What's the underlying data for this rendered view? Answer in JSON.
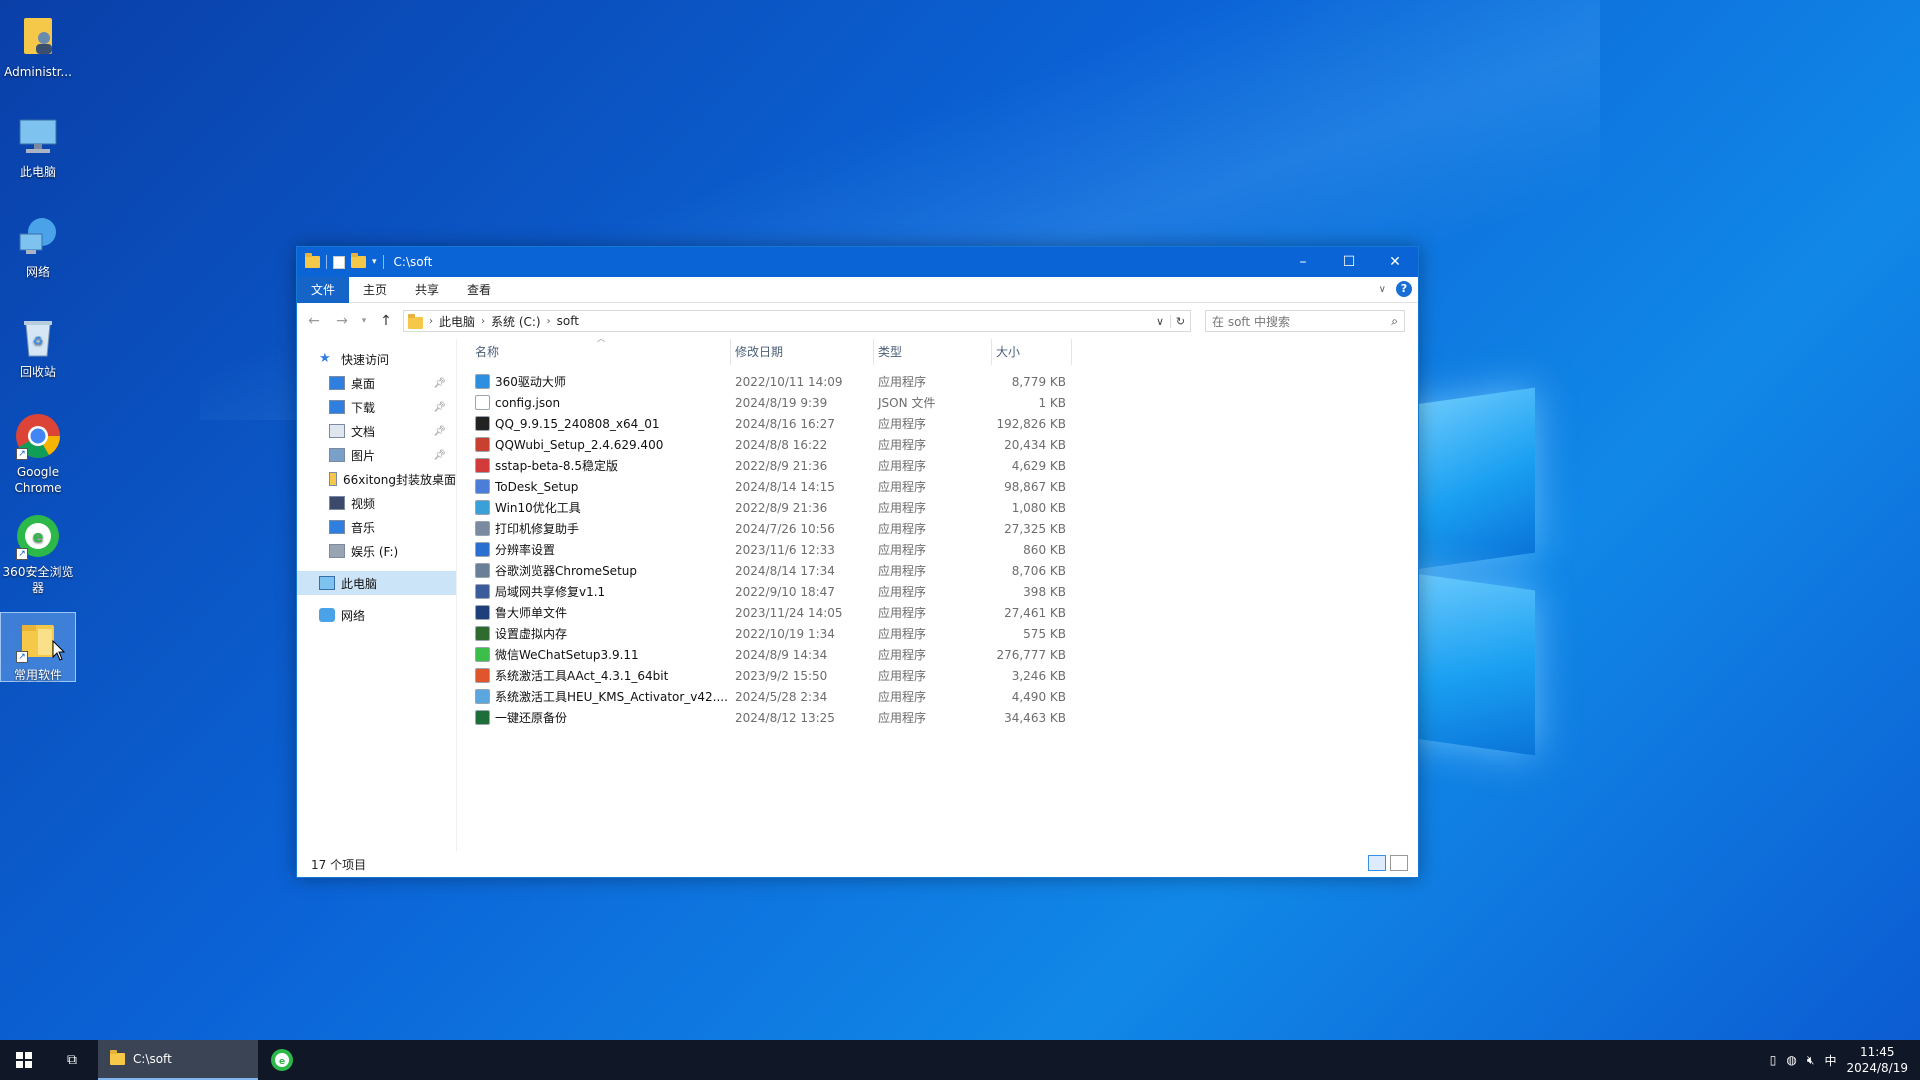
{
  "desktop": {
    "icons": [
      {
        "label": "Administr...",
        "icon": "user-folder-icon"
      },
      {
        "label": "此电脑",
        "icon": "this-pc-icon"
      },
      {
        "label": "网络",
        "icon": "network-icon"
      },
      {
        "label": "回收站",
        "icon": "recycle-bin-icon"
      },
      {
        "label": "Google Chrome",
        "icon": "chrome-icon"
      },
      {
        "label": "360安全浏览器",
        "icon": "360-browser-icon"
      },
      {
        "label": "常用软件",
        "icon": "folder-icon"
      }
    ]
  },
  "window": {
    "title": "C:\\soft",
    "ribbon_tabs": [
      "文件",
      "主页",
      "共享",
      "查看"
    ],
    "breadcrumb": [
      "此电脑",
      "系统 (C:)",
      "soft"
    ],
    "search_placeholder": "在 soft 中搜索",
    "nav": {
      "quick_access": "快速访问",
      "items": [
        {
          "label": "桌面",
          "icon": "desktop-icon",
          "pinned": true
        },
        {
          "label": "下载",
          "icon": "download-icon",
          "pinned": true
        },
        {
          "label": "文档",
          "icon": "document-icon",
          "pinned": true
        },
        {
          "label": "图片",
          "icon": "picture-icon",
          "pinned": true
        },
        {
          "label": "66xitong封装放桌面",
          "icon": "folder-icon",
          "pinned": false
        },
        {
          "label": "视频",
          "icon": "video-icon",
          "pinned": false
        },
        {
          "label": "音乐",
          "icon": "music-icon",
          "pinned": false
        },
        {
          "label": "娱乐 (F:)",
          "icon": "drive-icon",
          "pinned": false
        }
      ],
      "this_pc": "此电脑",
      "network": "网络"
    },
    "columns": {
      "name": "名称",
      "date": "修改日期",
      "type": "类型",
      "size": "大小"
    },
    "files": [
      {
        "name": "360驱动大师",
        "date": "2022/10/11 14:09",
        "type": "应用程序",
        "size": "8,779 KB",
        "color": "#2d8fe0"
      },
      {
        "name": "config.json",
        "date": "2024/8/19 9:39",
        "type": "JSON 文件",
        "size": "1 KB",
        "color": "#ffffff"
      },
      {
        "name": "QQ_9.9.15_240808_x64_01",
        "date": "2024/8/16 16:27",
        "type": "应用程序",
        "size": "192,826 KB",
        "color": "#222222"
      },
      {
        "name": "QQWubi_Setup_2.4.629.400",
        "date": "2024/8/8 16:22",
        "type": "应用程序",
        "size": "20,434 KB",
        "color": "#c8402f"
      },
      {
        "name": "sstap-beta-8.5稳定版",
        "date": "2022/8/9 21:36",
        "type": "应用程序",
        "size": "4,629 KB",
        "color": "#d33b3b"
      },
      {
        "name": "ToDesk_Setup",
        "date": "2024/8/14 14:15",
        "type": "应用程序",
        "size": "98,867 KB",
        "color": "#4a7ed8"
      },
      {
        "name": "Win10优化工具",
        "date": "2022/8/9 21:36",
        "type": "应用程序",
        "size": "1,080 KB",
        "color": "#3aa0d8"
      },
      {
        "name": "打印机修复助手",
        "date": "2024/7/26 10:56",
        "type": "应用程序",
        "size": "27,325 KB",
        "color": "#7a8aa0"
      },
      {
        "name": "分辨率设置",
        "date": "2023/11/6 12:33",
        "type": "应用程序",
        "size": "860 KB",
        "color": "#2a6fd0"
      },
      {
        "name": "谷歌浏览器ChromeSetup",
        "date": "2024/8/14 17:34",
        "type": "应用程序",
        "size": "8,706 KB",
        "color": "#6a7f98"
      },
      {
        "name": "局域网共享修复v1.1",
        "date": "2022/9/10 18:47",
        "type": "应用程序",
        "size": "398 KB",
        "color": "#3b5c9a"
      },
      {
        "name": "鲁大师单文件",
        "date": "2023/11/24 14:05",
        "type": "应用程序",
        "size": "27,461 KB",
        "color": "#1f3f7a"
      },
      {
        "name": "设置虚拟内存",
        "date": "2022/10/19 1:34",
        "type": "应用程序",
        "size": "575 KB",
        "color": "#2f6a2f"
      },
      {
        "name": "微信WeChatSetup3.9.11",
        "date": "2024/8/9 14:34",
        "type": "应用程序",
        "size": "276,777 KB",
        "color": "#3bbf4a"
      },
      {
        "name": "系统激活工具AAct_4.3.1_64bit",
        "date": "2023/9/2 15:50",
        "type": "应用程序",
        "size": "3,246 KB",
        "color": "#e0552b"
      },
      {
        "name": "系统激活工具HEU_KMS_Activator_v42....",
        "date": "2024/5/28 2:34",
        "type": "应用程序",
        "size": "4,490 KB",
        "color": "#5aa7e0"
      },
      {
        "name": "一键还原备份",
        "date": "2024/8/12 13:25",
        "type": "应用程序",
        "size": "34,463 KB",
        "color": "#1e6e3a"
      }
    ],
    "status": "17 个项目"
  },
  "taskbar": {
    "app_label": "C:\\soft",
    "ime": "中",
    "time": "11:45",
    "date": "2024/8/19"
  }
}
